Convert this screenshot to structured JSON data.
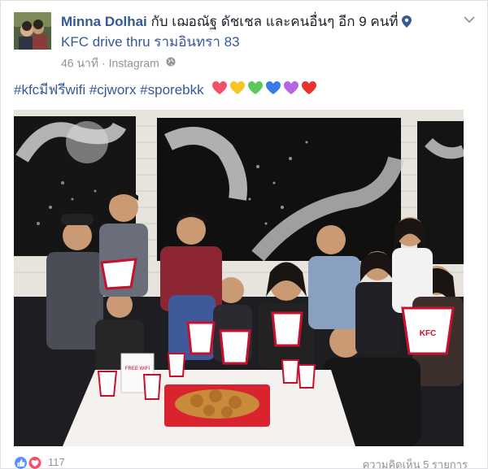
{
  "post": {
    "author": "Minna Dolhai",
    "with_text": " กับ เฌอณัฐ ดัชเชล และคนอื่นๆ อีก 9 คนที่",
    "place": "KFC drive thru รามอินทรา 83",
    "time": "46 นาที",
    "separator": " · ",
    "source": "Instagram",
    "caption": "#kfcมีฟรีwifi #cjworx #sporebkk",
    "heart_colors": [
      "#f25268",
      "#f7c325",
      "#5bc85b",
      "#3b7bea",
      "#b567e3",
      "#e8322c"
    ]
  },
  "photo": {
    "bucket_label": "KFC",
    "sign_text": "FREE WIFI"
  },
  "footer": {
    "reaction_count": "117",
    "comments": "ความคิดเห็น 5 รายการ"
  }
}
